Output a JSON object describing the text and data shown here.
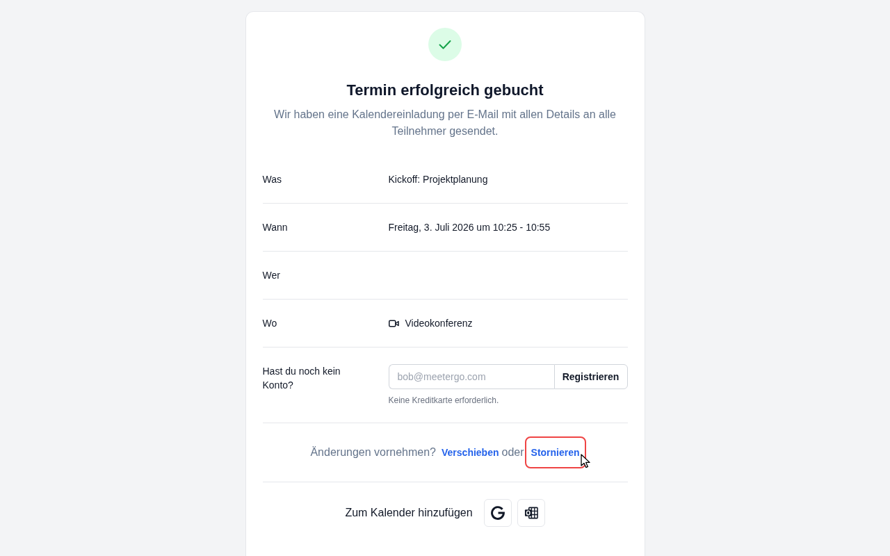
{
  "status": {
    "kind": "success"
  },
  "title": "Termin erfolgreich gebucht",
  "subtitle": "Wir haben eine Kalendereinladung per E-Mail mit allen Details an alle Teilnehmer gesendet.",
  "details": [
    {
      "kind": "text",
      "label": "Was",
      "value": "Kickoff: Projektplanung"
    },
    {
      "kind": "text",
      "label": "Wann",
      "value": "Freitag, 3. Juli 2026 um 10:25 - 10:55"
    },
    {
      "kind": "text",
      "label": "Wer"
    },
    {
      "kind": "location",
      "label": "Wo",
      "value": "Videokonferenz"
    },
    {
      "kind": "signup",
      "label": "Hast du noch kein Konto?",
      "placeholder": "bob@meetergo.com",
      "button": "Registrieren",
      "hint": "Keine Kreditkarte erforderlich."
    }
  ],
  "changes": {
    "prompt": "Änderungen vornehmen?",
    "separator": "oder",
    "links": [
      {
        "label": "Verschieben",
        "highlighted": false,
        "hovered": false
      },
      {
        "label": "Stornieren",
        "highlighted": true,
        "hovered": true
      }
    ]
  },
  "add_to_calendar": {
    "label": "Zum Kalender hinzufügen",
    "buttons": [
      {
        "kind": "google"
      },
      {
        "kind": "outlook"
      }
    ]
  }
}
